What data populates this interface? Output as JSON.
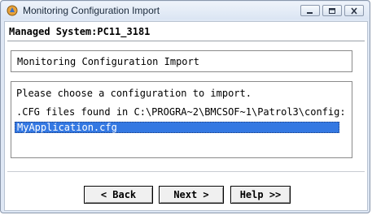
{
  "window": {
    "title": "Monitoring Configuration Import",
    "controls": [
      "minimize-icon",
      "restore-icon",
      "close-icon"
    ]
  },
  "managed_system": "Managed System:PC11_3181",
  "section_title": "Monitoring Configuration Import",
  "prompt": "Please choose a configuration to import.",
  "path_label": ".CFG files found in C:\\PROGRA~2\\BMCSOF~1\\Patrol3\\config:",
  "files": [
    "MyApplication.cfg"
  ],
  "selected_file": "MyApplication.cfg",
  "buttons": {
    "back": "< Back",
    "next": "Next >",
    "help": "Help >>"
  },
  "colors": {
    "selection": "#3478e2",
    "titlebar": "#dbe5f3"
  }
}
